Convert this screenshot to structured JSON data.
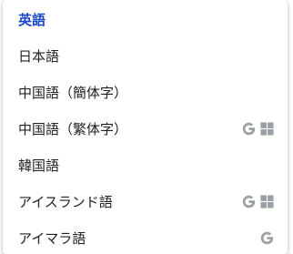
{
  "menu": {
    "items": [
      {
        "label": "英語",
        "selected": true,
        "icons": []
      },
      {
        "label": "日本語",
        "selected": false,
        "icons": []
      },
      {
        "label": "中国語（簡体字）",
        "selected": false,
        "icons": []
      },
      {
        "label": "中国語（繁体字）",
        "selected": false,
        "icons": [
          "google-g-icon",
          "grid-icon"
        ]
      },
      {
        "label": "韓国語",
        "selected": false,
        "icons": []
      },
      {
        "label": "アイスランド語",
        "selected": false,
        "icons": [
          "google-g-icon",
          "grid-icon"
        ]
      },
      {
        "label": "アイマラ語",
        "selected": false,
        "icons": [
          "google-g-icon"
        ]
      }
    ]
  },
  "colors": {
    "selected_text": "#1a47c6",
    "text": "#202124",
    "icon_gray": "#9aa0a6"
  }
}
